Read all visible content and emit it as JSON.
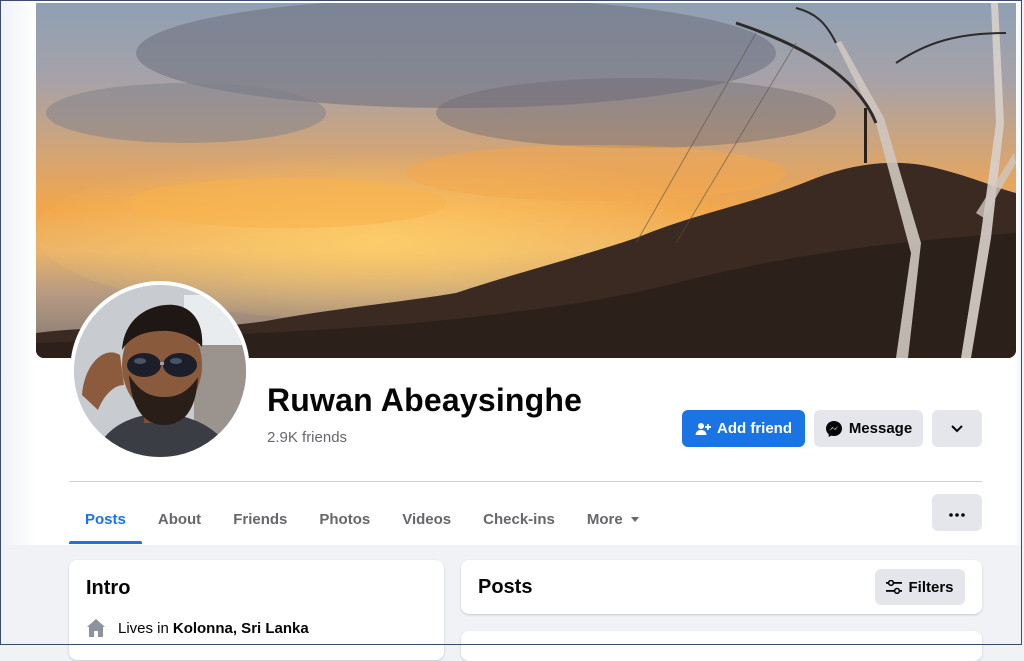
{
  "profile": {
    "name": "Ruwan Abeaysinghe",
    "friends_count": "2.9K friends"
  },
  "actions": {
    "add_friend": "Add friend",
    "message": "Message"
  },
  "tabs": [
    {
      "label": "Posts",
      "active": true
    },
    {
      "label": "About"
    },
    {
      "label": "Friends"
    },
    {
      "label": "Photos"
    },
    {
      "label": "Videos"
    },
    {
      "label": "Check-ins"
    },
    {
      "label": "More"
    }
  ],
  "intro": {
    "title": "Intro",
    "lives_label": "Lives in",
    "lives_place": "Kolonna, Sri Lanka"
  },
  "posts": {
    "title": "Posts",
    "filters_label": "Filters"
  },
  "colors": {
    "accent": "#1b74e4",
    "secondary_button": "#e4e6eb",
    "page_bg": "#f0f2f5"
  },
  "icons": [
    "add-friend-icon",
    "messenger-icon",
    "chevron-down-icon",
    "more-dots-icon",
    "home-icon",
    "filters-icon",
    "caret-down-icon"
  ]
}
